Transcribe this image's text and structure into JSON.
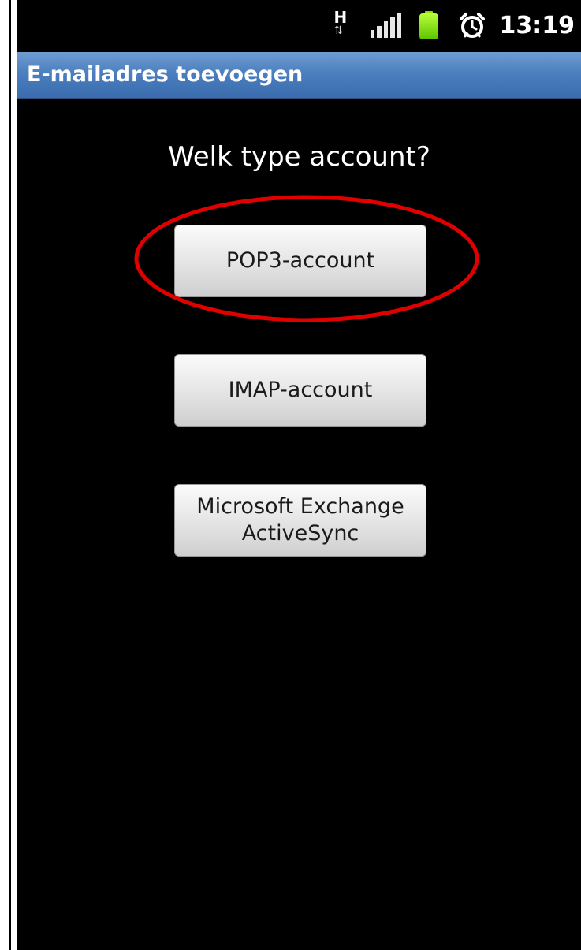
{
  "status_bar": {
    "network_type": "H",
    "time": "13:19",
    "icons": [
      "hsdpa-data-icon",
      "signal-strength-icon",
      "battery-icon",
      "alarm-clock-icon"
    ],
    "battery_color": "#7ed600"
  },
  "title_bar": {
    "title": "E-mailadres toevoegen",
    "color": "#4c7fbf"
  },
  "main": {
    "question": "Welk type account?",
    "buttons": [
      {
        "label": "POP3-account",
        "highlighted": true
      },
      {
        "label": "IMAP-account",
        "highlighted": false
      },
      {
        "label": "Microsoft Exchange\nActiveSync",
        "highlighted": false
      }
    ],
    "highlight_color": "#e00000"
  }
}
